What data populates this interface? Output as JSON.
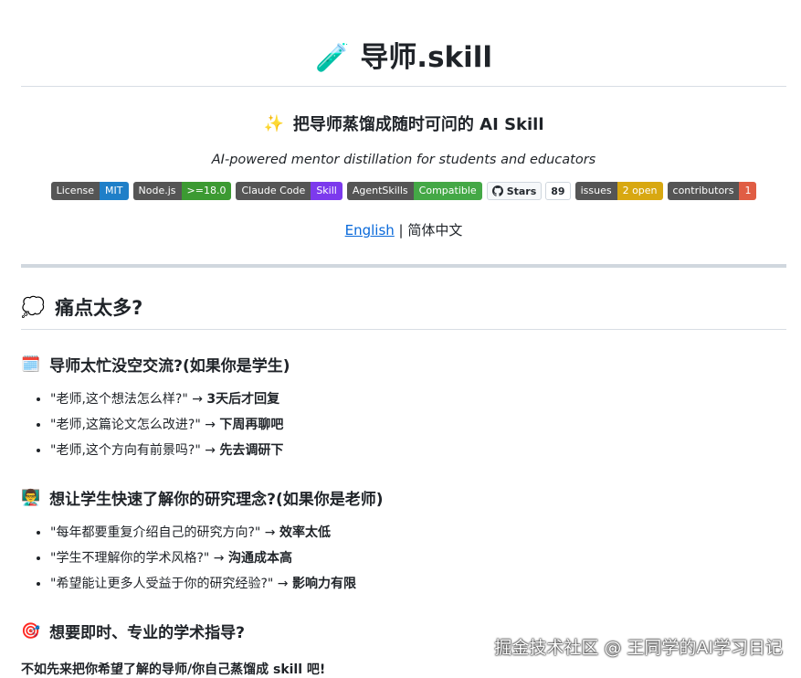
{
  "header": {
    "title_icon": "test-tube-icon",
    "title_emoji": "🧪",
    "title": "导师.skill"
  },
  "tagline": {
    "icon": "sparkles-icon",
    "emoji": "✨",
    "text": "把导师蒸馏成随时可问的 AI Skill"
  },
  "subtitle": "AI-powered mentor distillation for students and educators",
  "badges": [
    {
      "left": "License",
      "right": "MIT",
      "color": "#1f7fc8"
    },
    {
      "left": "Node.js",
      "right": ">=18.0",
      "color": "#3c9a32"
    },
    {
      "left": "Claude Code",
      "right": "Skill",
      "color": "#7c3aed"
    },
    {
      "left": "AgentSkills",
      "right": "Compatible",
      "color": "#44a846"
    }
  ],
  "stars": {
    "label": "Stars",
    "count": "89"
  },
  "badges2": [
    {
      "left": "issues",
      "right": "2 open",
      "color": "#d8a811"
    },
    {
      "left": "contributors",
      "right": "1",
      "color": "#e05d44"
    }
  ],
  "language": {
    "english": "English",
    "separator": " | ",
    "chinese": "简体中文"
  },
  "section": {
    "icon": "thought-bubble-icon",
    "emoji": "💭",
    "title": "痛点太多?"
  },
  "groups": [
    {
      "icon": "calendar-icon",
      "emoji": "🗓️",
      "title": "导师太忙没空交流?(如果你是学生)",
      "items": [
        {
          "q": "\"老师,这个想法怎么样?\" → ",
          "a": "3天后才回复"
        },
        {
          "q": "\"老师,这篇论文怎么改进?\" → ",
          "a": "下周再聊吧"
        },
        {
          "q": "\"老师,这个方向有前景吗?\" → ",
          "a": "先去调研下"
        }
      ]
    },
    {
      "icon": "teacher-icon",
      "emoji": "👨‍🏫",
      "title": "想让学生快速了解你的研究理念?(如果你是老师)",
      "items": [
        {
          "q": "\"每年都要重复介绍自己的研究方向?\" → ",
          "a": "效率太低"
        },
        {
          "q": "\"学生不理解你的学术风格?\" → ",
          "a": "沟通成本高"
        },
        {
          "q": "\"希望能让更多人受益于你的研究经验?\" → ",
          "a": "影响力有限"
        }
      ]
    },
    {
      "icon": "target-icon",
      "emoji": "🎯",
      "title": "想要即时、专业的学术指导?",
      "items": []
    }
  ],
  "bottom_line": "不如先来把你希望了解的导师/你自己蒸馏成 skill 吧!",
  "watermark": "掘金技术社区 @ 王同学的AI学习日记"
}
